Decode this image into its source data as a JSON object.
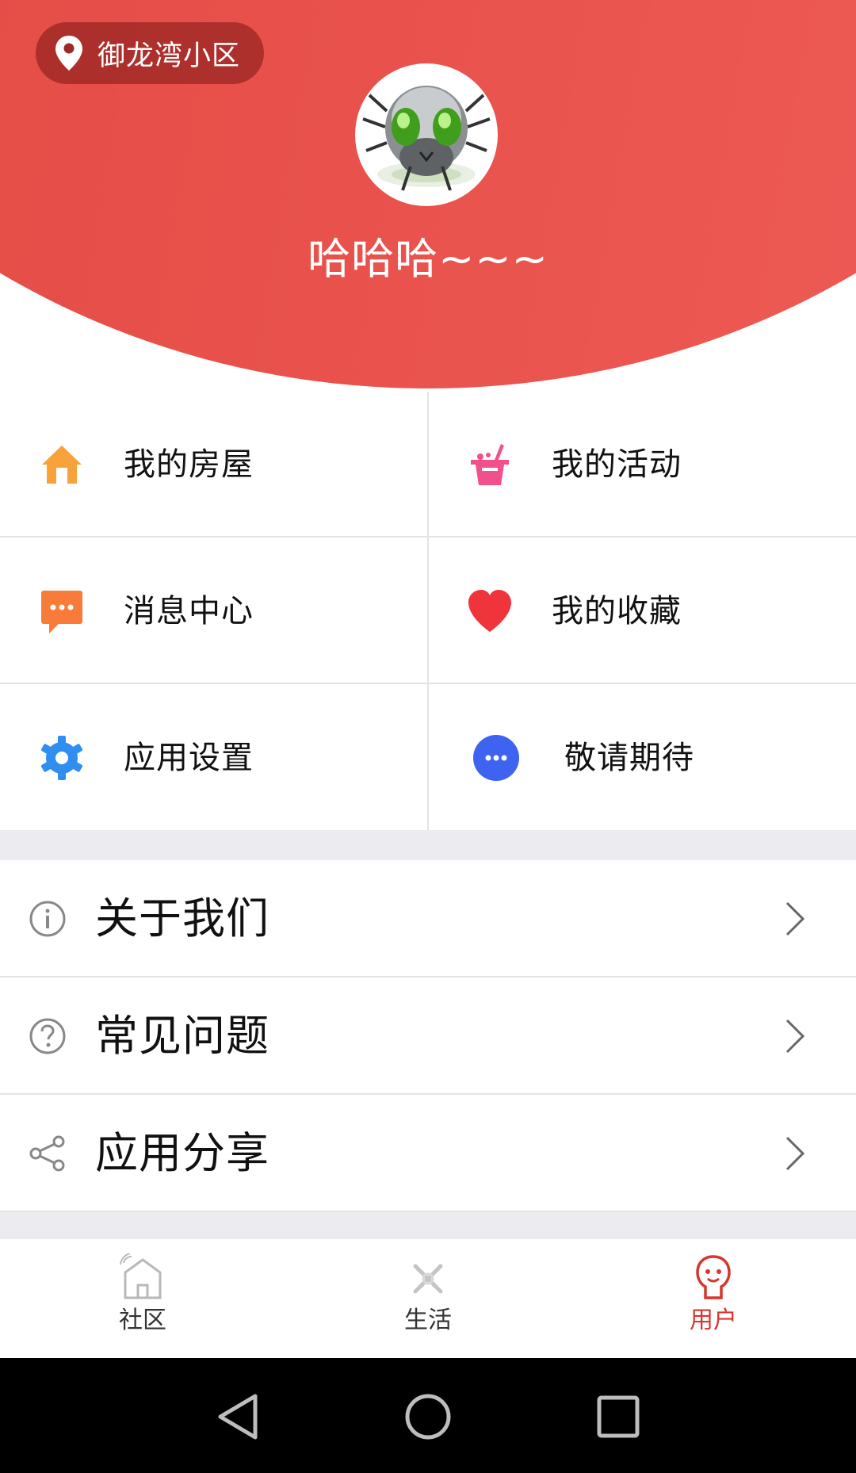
{
  "header": {
    "location": "御龙湾小区",
    "username": "哈哈哈~~~"
  },
  "grid": {
    "items": [
      {
        "label": "我的房屋",
        "icon": "house-icon",
        "color": "#f7a23b"
      },
      {
        "label": "我的活动",
        "icon": "ice-bucket-icon",
        "color": "#f2508a"
      },
      {
        "label": "消息中心",
        "icon": "message-icon",
        "color": "#f97b3a"
      },
      {
        "label": "我的收藏",
        "icon": "heart-icon",
        "color": "#f0343c"
      },
      {
        "label": "应用设置",
        "icon": "gear-icon",
        "color": "#2f8ef0"
      },
      {
        "label": "敬请期待",
        "icon": "more-icon",
        "color": "#3d63f0"
      }
    ]
  },
  "list": {
    "items": [
      {
        "label": "关于我们",
        "icon": "info-icon"
      },
      {
        "label": "常见问题",
        "icon": "question-icon"
      },
      {
        "label": "应用分享",
        "icon": "share-icon"
      }
    ]
  },
  "tabbar": {
    "tabs": [
      {
        "label": "社区",
        "icon": "community-icon",
        "active": false
      },
      {
        "label": "生活",
        "icon": "life-icon",
        "active": false
      },
      {
        "label": "用户",
        "icon": "user-icon",
        "active": true
      }
    ],
    "active_color": "#d8352f"
  },
  "colors": {
    "brand_red": "#e9524c",
    "divider": "#e3e3e3",
    "section_bg": "#ececf0"
  }
}
